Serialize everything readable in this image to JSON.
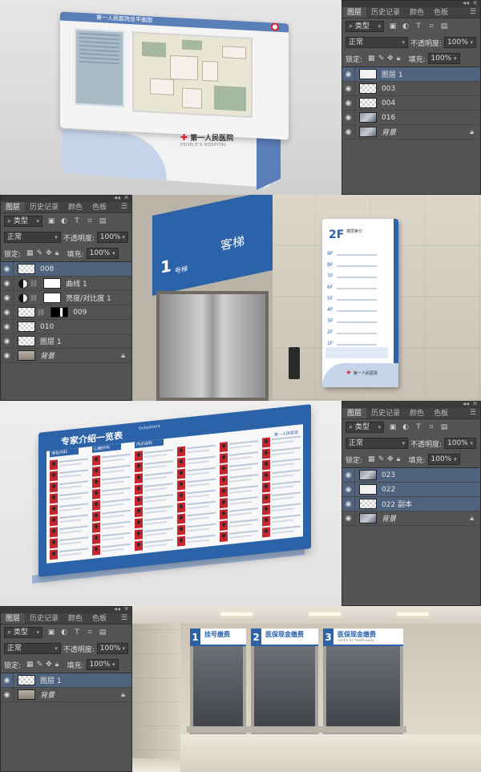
{
  "ps_panels": {
    "tabs": [
      "图层",
      "历史记录",
      "颜色",
      "色板"
    ],
    "filter_label": "类型",
    "mode": "正常",
    "opacity_label": "不透明度:",
    "opacity_value": "100%",
    "lock_label": "锁定:",
    "fill_label": "填充:",
    "fill_value": "100%"
  },
  "panel1_layers": [
    {
      "name": "图层 1",
      "thumb": "doc",
      "selected": true
    },
    {
      "name": "003",
      "thumb": "trans",
      "selected": false
    },
    {
      "name": "004",
      "thumb": "trans",
      "selected": false
    },
    {
      "name": "016",
      "thumb": "img",
      "selected": false
    },
    {
      "name": "背景",
      "thumb": "img",
      "selected": false,
      "italic": true,
      "locked": true
    }
  ],
  "panel2_layers": [
    {
      "name": "008",
      "thumb": "trans",
      "selected": true
    },
    {
      "name": "曲线 1",
      "adjust": true,
      "selected": false
    },
    {
      "name": "亮度/对比度 1",
      "adjust": true,
      "selected": false
    },
    {
      "name": "009",
      "thumb": "trans",
      "mask": true,
      "selected": false
    },
    {
      "name": "010",
      "thumb": "trans",
      "selected": false
    },
    {
      "name": "图层 1",
      "thumb": "trans",
      "selected": false
    },
    {
      "name": "背景",
      "thumb": "bg-room",
      "selected": false,
      "italic": true,
      "locked": true
    }
  ],
  "panel3_layers": [
    {
      "name": "023",
      "thumb": "img",
      "selected": true
    },
    {
      "name": "022",
      "thumb": "doc",
      "selected": true
    },
    {
      "name": "022 副本",
      "thumb": "trans",
      "selected": true
    },
    {
      "name": "背景",
      "thumb": "img",
      "selected": false,
      "italic": true,
      "locked": true
    }
  ],
  "panel4_layers": [
    {
      "name": "图层 1",
      "thumb": "trans",
      "selected": true
    },
    {
      "name": "背景",
      "thumb": "bg-room",
      "selected": false,
      "italic": true,
      "locked": true
    }
  ],
  "scene1": {
    "board_title": "第一人民医院总平面图",
    "hospital_name": "第一人民医院",
    "hospital_en": "PEOPLE'S HOSPITAL"
  },
  "scene2": {
    "elevator_number": "1",
    "elevator_label": "号梯",
    "elevator_title": "客梯",
    "floor_big": "2F",
    "floor_index_title": "楼层索引",
    "floors": [
      "9F",
      "8F",
      "7F",
      "6F",
      "5F",
      "4F",
      "3F",
      "2F",
      "1F"
    ],
    "hospital_name": "第一人民医院"
  },
  "scene3": {
    "title": "专家介绍一览表",
    "subtitle": "Outpatient",
    "departments": [
      "消化内科",
      "心胸外科",
      "内分泌科",
      "",
      "",
      ""
    ],
    "logo": "第一人民医院"
  },
  "scene4": {
    "windows": [
      {
        "num": "1",
        "title": "挂号缴费"
      },
      {
        "num": "2",
        "title": "医保现金缴费"
      },
      {
        "num": "3",
        "title": "医保现金缴费",
        "sub": "Centre for health body"
      }
    ]
  },
  "colors": {
    "brand_blue": "#2c63a8",
    "ps_bg": "#535353",
    "ps_selected": "#50637e",
    "red_cross": "#d6242b"
  }
}
